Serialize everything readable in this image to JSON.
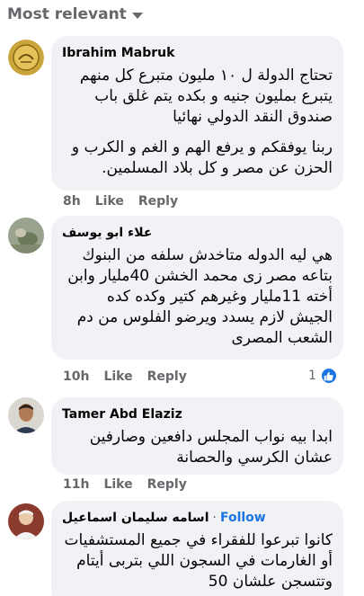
{
  "sort": {
    "label": "Most relevant"
  },
  "comments": [
    {
      "author": "Ibrahim Mabruk",
      "paragraphs": [
        "تحتاج الدولة ل ١٠ مليون متبرع كل منهم يتبرع بمليون جنيه و بكده يتم غلق باب صندوق النقد الدولي نهائيا",
        "ربنا يوفقكم و يرفع الهم و الغم و الكرب و الحزن عن مصر و كل بلاد المسلمين."
      ],
      "time": "8h",
      "like_label": "Like",
      "reply_label": "Reply"
    },
    {
      "author": "علاء ابو يوسف",
      "paragraphs": [
        "هي ليه الدوله متاخدش سلفه من البنوك بتاعه مصر زى محمد الخشن 40مليار وابن أخته 11مليار وغيرهم كتير وكده كده الجيش لازم يسدد ويرضو الفلوس من دم الشعب المصرى"
      ],
      "time": "10h",
      "like_label": "Like",
      "reply_label": "Reply",
      "reaction_count": "1"
    },
    {
      "author": "Tamer Abd Elaziz",
      "paragraphs": [
        "ابدا بيه نواب المجلس دافعين وصارفين عشان الكرسي والحصانة"
      ],
      "time": "11h",
      "like_label": "Like",
      "reply_label": "Reply"
    },
    {
      "author": "اسامه سليمان اسماعيل",
      "follow_label": "Follow",
      "paragraphs": [
        "كانوا تبرعوا للفقراء في جميع المستشفيات أو الغارمات في السجون اللي بتربى أيتام وتتسجن علشان 50"
      ]
    }
  ],
  "colors": {
    "bubble": "#f0f2f5",
    "meta_text": "#65676b",
    "accent": "#1b74e4"
  }
}
